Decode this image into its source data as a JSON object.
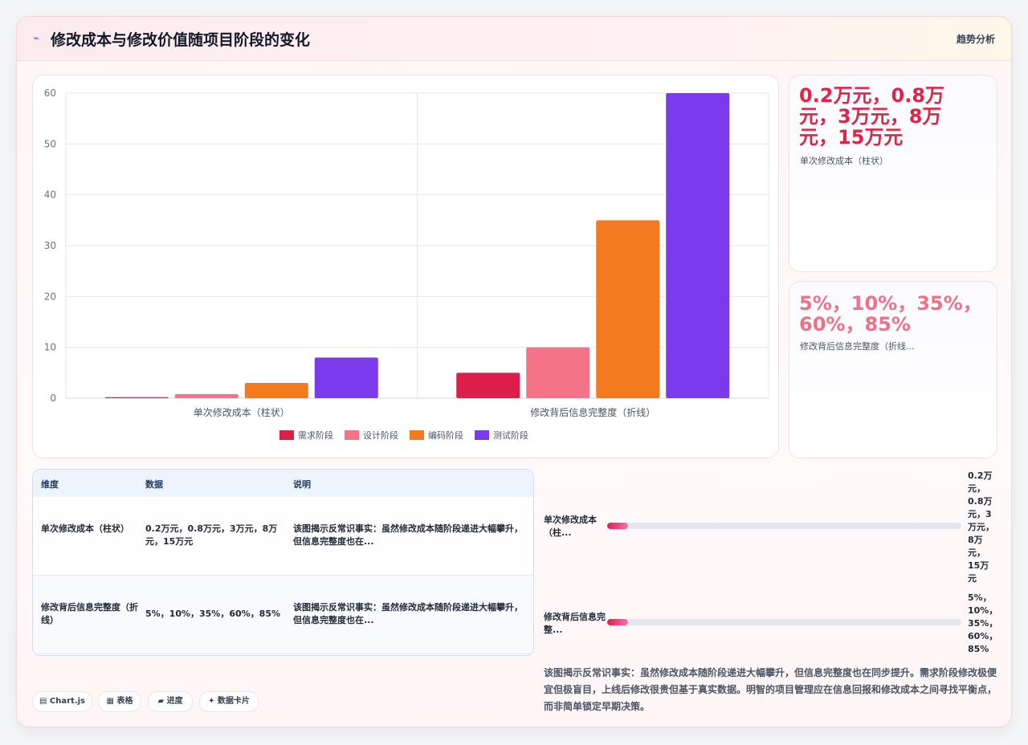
{
  "header": {
    "icon": "chart-line-icon",
    "title": "修改成本与修改价值随项目阶段的变化",
    "tag": "趋势分析"
  },
  "chart_data": {
    "type": "bar",
    "categories": [
      "单次修改成本（柱状）",
      "修改背后信息完整度（折线）"
    ],
    "series": [
      {
        "name": "需求阶段",
        "values": [
          0.2,
          5
        ],
        "color": "#dc1e4a"
      },
      {
        "name": "设计阶段",
        "values": [
          0.8,
          10
        ],
        "color": "#f47386"
      },
      {
        "name": "编码阶段",
        "values": [
          3,
          35
        ],
        "color": "#f47a1f"
      },
      {
        "name": "测试阶段",
        "values": [
          8,
          60
        ],
        "color": "#7c3aed"
      }
    ],
    "ylim": [
      0,
      60
    ],
    "yticks": [
      0,
      10,
      20,
      30,
      40,
      50,
      60
    ],
    "grid": true,
    "legend": "bottom"
  },
  "stats": [
    {
      "value": "0.2万元，0.8万元，3万元，8万元，15万元",
      "label": "单次修改成本（柱状）"
    },
    {
      "value": "5%，10%，35%，60%，85%",
      "label": "修改背后信息完整度（折线..."
    }
  ],
  "table": {
    "headers": [
      "维度",
      "数据",
      "说明"
    ],
    "rows": [
      [
        "单次修改成本（柱状）",
        "0.2万元，0.8万元，3万元，8万元，15万元",
        "该图揭示反常识事实：虽然修改成本随阶段递进大幅攀升，但信息完整度也在..."
      ],
      [
        "修改背后信息完整度（折线）",
        "5%，10%，35%，60%，85%",
        "该图揭示反常识事实：虽然修改成本随阶段递进大幅攀升，但信息完整度也在..."
      ]
    ]
  },
  "progress": [
    {
      "label": "单次修改成本（柱...",
      "value": "0.2万元，0.8万元，3万元，8万元，15万元",
      "fraction": 0.06
    },
    {
      "label": "修改背后信息完整...",
      "value": "5%，10%，35%，60%，85%",
      "fraction": 0.06
    }
  ],
  "chips": [
    {
      "label": "▤ Chart.js",
      "icon": "chart-icon"
    },
    {
      "label": "▦ 表格",
      "icon": "table-icon"
    },
    {
      "label": "▰ 进度",
      "icon": "progress-icon"
    },
    {
      "label": "✦ 数据卡片",
      "icon": "sparkle-icon"
    }
  ],
  "summary": "该图揭示反常识事实：虽然修改成本随阶段递进大幅攀升，但信息完整度也在同步提升。需求阶段修改极便宜但极盲目，上线后修改很贵但基于真实数据。明智的项目管理应在信息回报和修改成本之间寻找平衡点，而非简单锁定早期决策。"
}
